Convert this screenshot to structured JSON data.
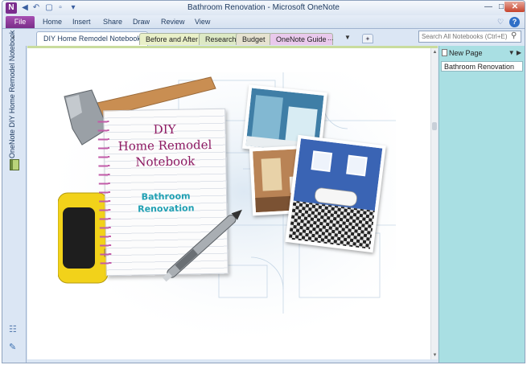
{
  "window": {
    "title": "Bathroom Renovation - Microsoft OneNote",
    "app_logo": "N",
    "qat_icons": [
      "back-icon",
      "undo-icon",
      "dock-icon",
      "customize-icon"
    ],
    "controls": [
      "minimize-icon",
      "maximize-icon",
      "close-icon"
    ]
  },
  "ribbon": {
    "file_label": "File",
    "tabs": [
      "Home",
      "Insert",
      "Share",
      "Draw",
      "Review",
      "View"
    ],
    "right_icons": [
      "heart-icon",
      "help-icon"
    ],
    "help_glyph": "?"
  },
  "notebook": {
    "title": "DIY Home Remodel Notebook",
    "sections": [
      {
        "label": "Before and After",
        "color": "#e9f0c8"
      },
      {
        "label": "Research",
        "color": "#dde9c5"
      },
      {
        "label": "Budget",
        "color": "#e6e2d0"
      },
      {
        "label": "OneNote Guide",
        "color": "#e9c9ec"
      }
    ],
    "more_label": "...",
    "search_placeholder": "Search All Notebooks (Ctrl+E)"
  },
  "leftbar": {
    "label": "OneNote DIY Home Remodel Notebook"
  },
  "cover": {
    "title_lines": [
      "DIY",
      "Home Remodel",
      "Notebook"
    ],
    "subtitle_lines": [
      "Bathroom",
      "Renovation"
    ],
    "colors": {
      "title": "#8e1a63",
      "subtitle": "#20a0b3",
      "spiral": "#c25ba8"
    }
  },
  "pagepane": {
    "new_page_label": "New Page",
    "pages": [
      "Bathroom Renovation"
    ]
  }
}
